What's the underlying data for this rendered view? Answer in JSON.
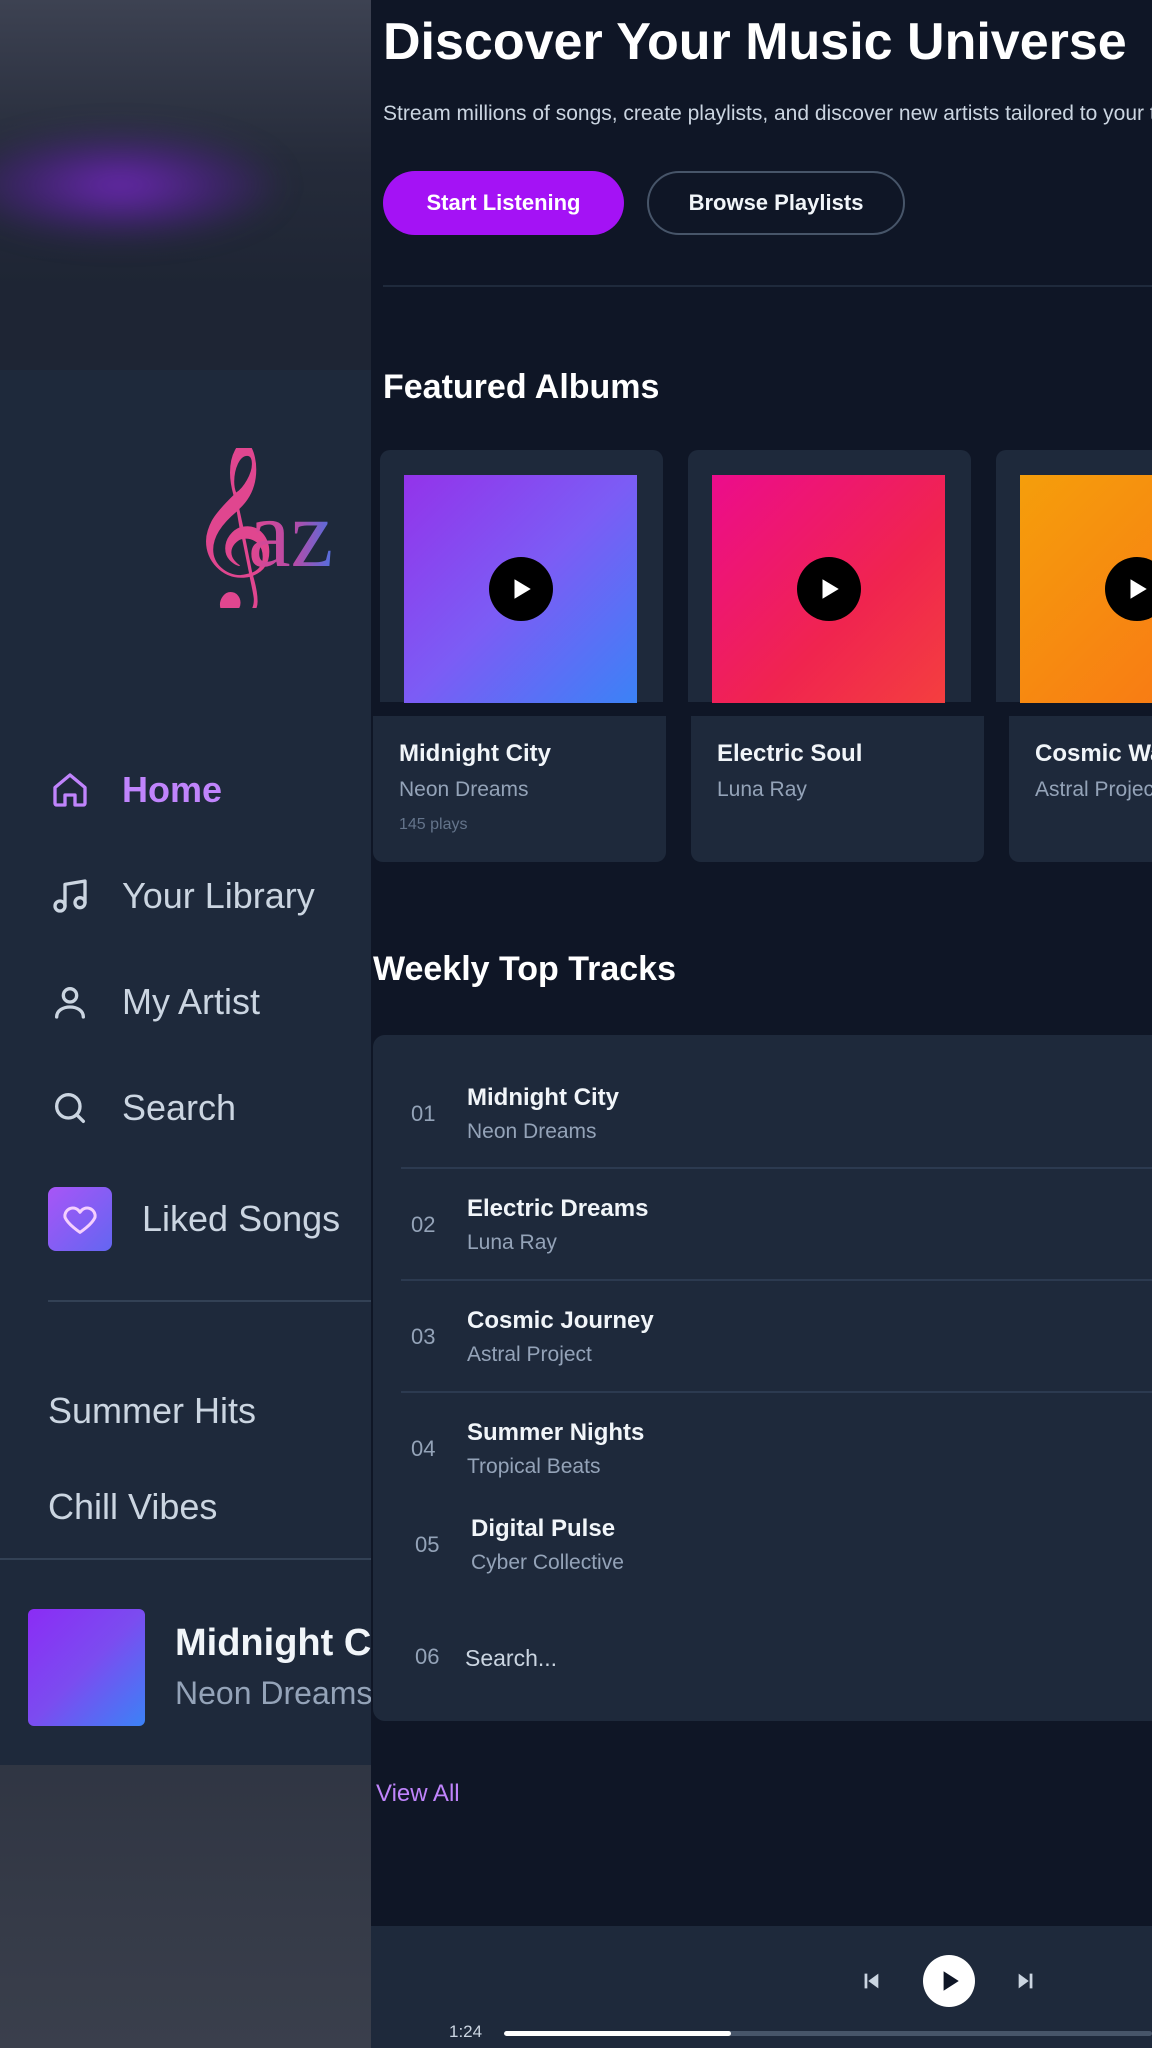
{
  "hero": {
    "title": "Discover Your Music Universe",
    "subtitle": "Stream millions of songs, create playlists, and discover new artists tailored to your taste.",
    "primary_button": "Start Listening",
    "secondary_button": "Browse Playlists"
  },
  "sidebar": {
    "logo_text": "az",
    "nav": [
      {
        "label": "Home",
        "icon": "home-icon",
        "active": true
      },
      {
        "label": "Your Library",
        "icon": "music-note-icon",
        "active": false
      },
      {
        "label": "My Artist",
        "icon": "user-icon",
        "active": false
      },
      {
        "label": "Search",
        "icon": "search-icon",
        "active": false
      },
      {
        "label": "Liked Songs",
        "icon": "heart-icon",
        "active": false
      }
    ],
    "playlists": [
      "Summer Hits",
      "Chill Vibes"
    ],
    "now_playing": {
      "title": "Midnight City",
      "artist": "Neon Dreams"
    }
  },
  "featured": {
    "heading": "Featured Albums",
    "albums": [
      {
        "title": "Midnight City",
        "artist": "Neon Dreams",
        "plays": "145 plays",
        "gradient": [
          "#9333ea",
          "#3b82f6"
        ]
      },
      {
        "title": "Electric Soul",
        "artist": "Luna Ray",
        "plays": "",
        "gradient": [
          "#ec0c7c",
          "#f43f3f"
        ]
      },
      {
        "title": "Cosmic Wanderer",
        "artist": "Astral Project",
        "plays": "",
        "gradient": [
          "#f59e0b",
          "#f97316"
        ]
      }
    ]
  },
  "tracks": {
    "heading": "Weekly Top Tracks",
    "items": [
      {
        "num": "01",
        "title": "Midnight City",
        "artist": "Neon Dreams"
      },
      {
        "num": "02",
        "title": "Electric Dreams",
        "artist": "Luna Ray"
      },
      {
        "num": "03",
        "title": "Cosmic Journey",
        "artist": "Astral Project"
      },
      {
        "num": "04",
        "title": "Summer Nights",
        "artist": "Tropical Beats"
      },
      {
        "num": "05",
        "title": "Digital Pulse",
        "artist": "Cyber Collective"
      }
    ],
    "search_num": "06",
    "search_placeholder": "Search...",
    "view_all": "View All"
  },
  "player": {
    "current_time": "1:24",
    "progress": 0.35
  },
  "colors": {
    "accent": "#a412f5",
    "accent_text": "#c084fc",
    "panel": "#1e293b",
    "background": "#0f1626"
  }
}
